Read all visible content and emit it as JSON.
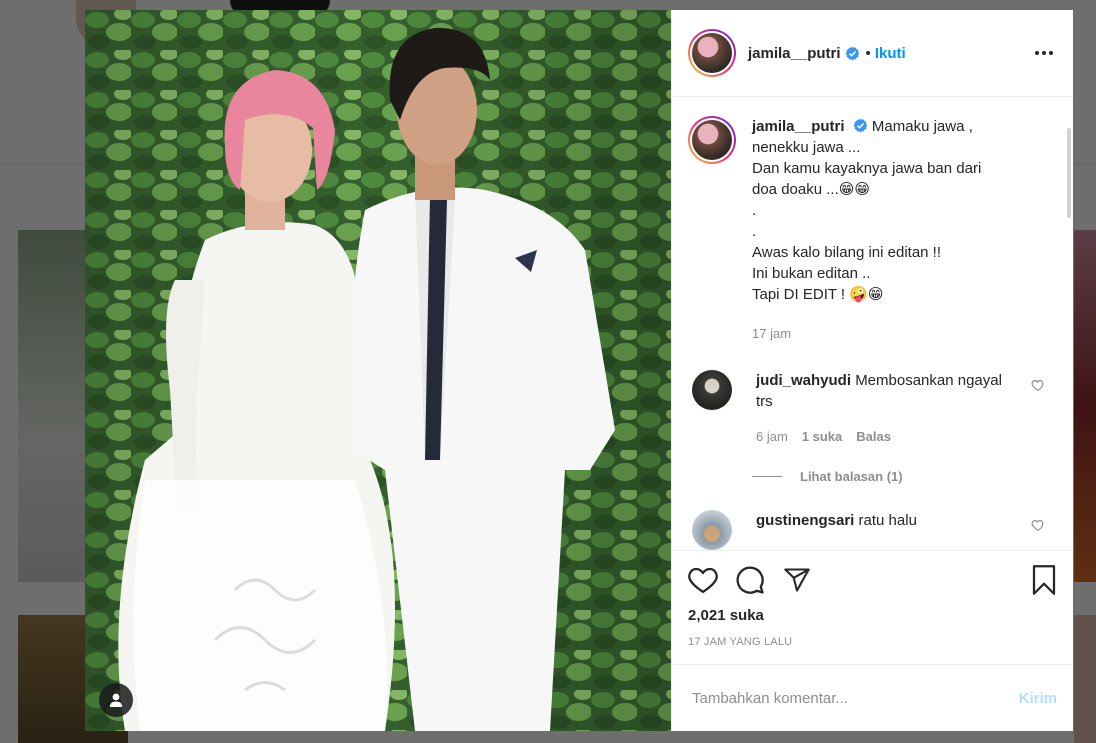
{
  "post": {
    "author": "jamila__putri",
    "follow_label": "Ikuti",
    "dot": "•",
    "caption_lines": [
      "Mamaku jawa ,",
      "nenekku jawa ...",
      "Dan kamu kayaknya jawa ban dari",
      "doa doaku ...😁😁",
      ".",
      ".",
      "Awas kalo bilang ini editan !!",
      "Ini bukan editan ..",
      "Tapi DI EDIT ! 🤪😁"
    ],
    "caption_time": "17 jam",
    "likes": "2,021 suka",
    "timestamp": "17 JAM YANG LALU"
  },
  "comments": [
    {
      "user": "judi_wahyudi",
      "text": "Membosankan ngayal trs",
      "time": "6 jam",
      "likes": "1 suka",
      "reply_label": "Balas",
      "view_replies": "Lihat balasan (1)"
    },
    {
      "user": "gustinengsari",
      "text": "ratu halu"
    }
  ],
  "add_comment": {
    "placeholder": "Tambahkan komentar...",
    "post_label": "Kirim"
  },
  "colors": {
    "accent": "#0095f6",
    "verified": "#3897f0",
    "post_disabled": "#b2dffc"
  },
  "icons": [
    "verified-icon",
    "more-options-icon",
    "heart-icon",
    "comment-icon",
    "share-icon",
    "bookmark-icon",
    "user-tag-icon"
  ]
}
